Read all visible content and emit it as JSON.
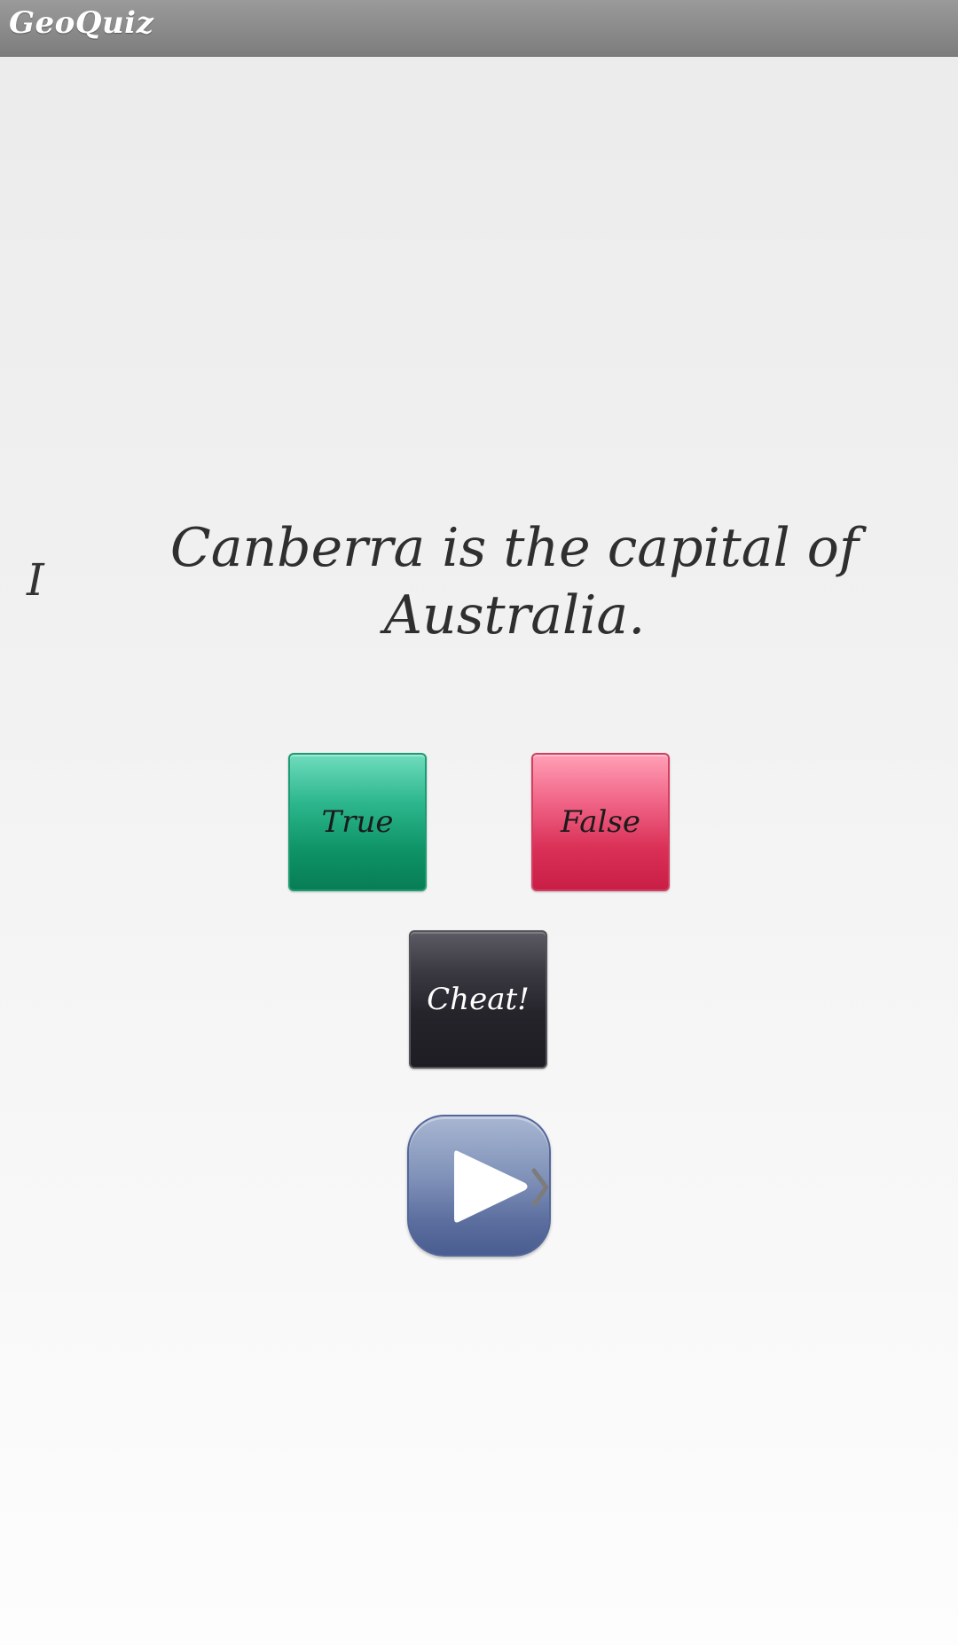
{
  "app": {
    "title": "GeoQuiz"
  },
  "quiz": {
    "question_index": "I",
    "question_text": "Canberra is the capital of Australia."
  },
  "buttons": {
    "true_label": "True",
    "false_label": "False",
    "cheat_label": "Cheat!"
  },
  "icons": {
    "next": "play-icon",
    "next_hint": "chevron-right-icon"
  },
  "colors": {
    "true_button": "#0e9467",
    "false_button": "#da2f56",
    "cheat_button": "#26242b",
    "next_button": "#5c6f9f",
    "title_bar": "#8a8a8a"
  }
}
